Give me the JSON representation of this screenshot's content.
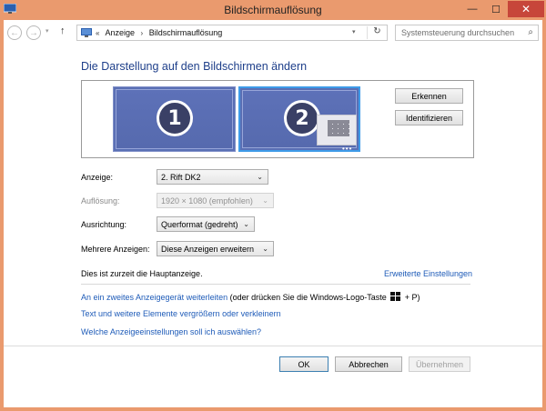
{
  "window": {
    "title": "Bildschirmauflösung",
    "min": "—",
    "max": "☐",
    "close": "✕"
  },
  "nav": {
    "back": "←",
    "forward": "→",
    "recent": "▾",
    "up": "↑",
    "crumbs": [
      "«",
      "Anzeige",
      "›",
      "Bildschirmauflösung"
    ],
    "address_dropdown": "▾",
    "refresh": "↻",
    "search_placeholder": "Systemsteuerung durchsuchen",
    "search_icon": "⌕"
  },
  "main": {
    "heading": "Die Darstellung auf den Bildschirmen ändern",
    "monitors": [
      {
        "number": "1"
      },
      {
        "number": "2",
        "dots": "•••"
      }
    ],
    "detect_label": "Erkennen",
    "identify_label": "Identifizieren",
    "fields": [
      {
        "label": "Anzeige:",
        "value": "2. Rift DK2",
        "enabled": true
      },
      {
        "label": "Auflösung:",
        "value": "1920 × 1080 (empfohlen)",
        "enabled": false
      },
      {
        "label": "Ausrichtung:",
        "value": "Querformat (gedreht)",
        "enabled": true
      },
      {
        "label": "Mehrere Anzeigen:",
        "value": "Diese Anzeigen erweitern",
        "enabled": true
      }
    ],
    "dropdown_arrow": "⌄",
    "main_display_text": "Dies ist zurzeit die Hauptanzeige.",
    "advanced_link": "Erweiterte Einstellungen",
    "project_link": "An ein zweites Anzeigegerät weiterleiten",
    "project_hint_pre": "(oder drücken Sie die Windows-Logo-Taste",
    "project_hint_post": "+ P)",
    "text_size_link": "Text und weitere Elemente vergrößern oder verkleinern",
    "which_settings_link": "Welche Anzeigeeinstellungen soll ich auswählen?"
  },
  "footer": {
    "ok": "OK",
    "cancel": "Abbrechen",
    "apply": "Übernehmen"
  },
  "colors": {
    "accent": "#1e5bb8",
    "heading": "#1e3f8a",
    "monitor": "#5a6fb4",
    "selected_border": "#3e9be8",
    "titlebar": "#ea9a6e",
    "close": "#c7463a"
  }
}
